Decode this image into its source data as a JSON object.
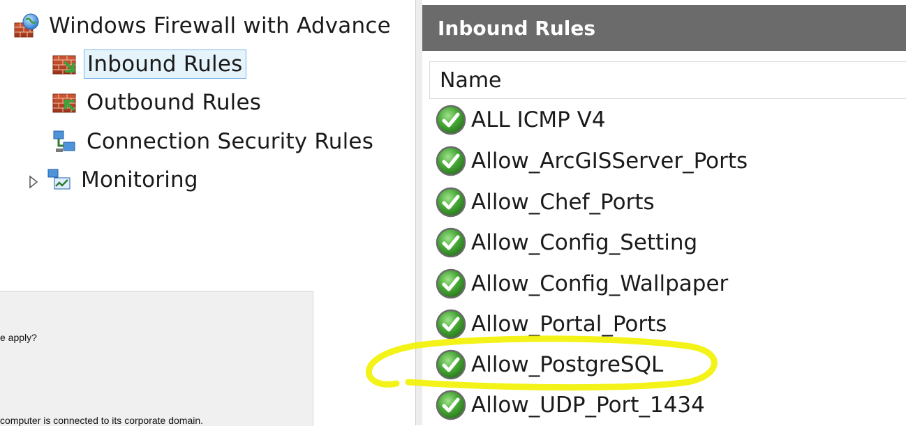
{
  "tree": {
    "root_label": "Windows Firewall with Advance",
    "items": [
      {
        "label": "Inbound Rules",
        "icon": "inbound-rules-icon",
        "selected": true
      },
      {
        "label": "Outbound Rules",
        "icon": "outbound-rules-icon"
      },
      {
        "label": "Connection Security Rules",
        "icon": "connection-security-icon"
      },
      {
        "label": "Monitoring",
        "icon": "monitoring-icon",
        "expandable": true
      }
    ]
  },
  "wizard_fragment": {
    "question": "e apply?",
    "domain_text": " computer is connected to its corporate domain."
  },
  "rules_pane": {
    "title": "Inbound Rules",
    "column_header": "Name",
    "rows": [
      {
        "name": "ALL ICMP V4",
        "enabled": true
      },
      {
        "name": "Allow_ArcGISServer_Ports",
        "enabled": true
      },
      {
        "name": "Allow_Chef_Ports",
        "enabled": true
      },
      {
        "name": "Allow_Config_Setting",
        "enabled": true
      },
      {
        "name": "Allow_Config_Wallpaper",
        "enabled": true
      },
      {
        "name": "Allow_Portal_Ports",
        "enabled": true
      },
      {
        "name": "Allow_PostgreSQL",
        "enabled": true,
        "highlighted": true
      },
      {
        "name": "Allow_UDP_Port_1434",
        "enabled": true
      }
    ]
  },
  "colors": {
    "header_bg": "#6b6b6b",
    "selection_border": "#7eb4ea",
    "selection_bg": "#e5f3fb",
    "check_green": "#3c9a2f",
    "annotation": "#f2f200"
  }
}
